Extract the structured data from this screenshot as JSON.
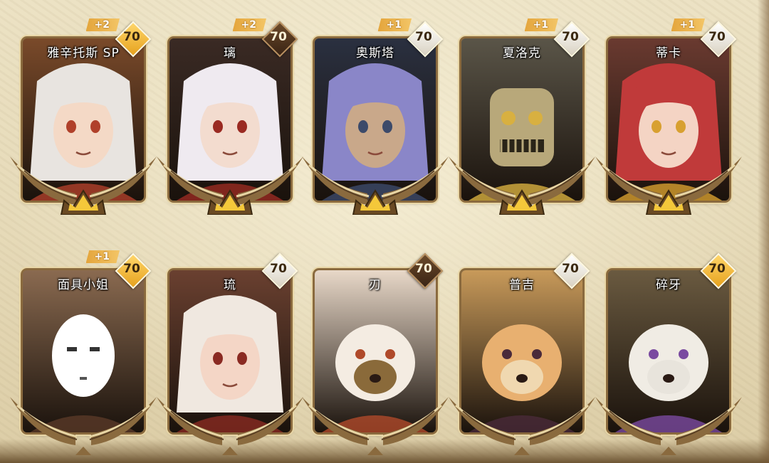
{
  "heroes": [
    {
      "name": "雅辛托斯 SP",
      "level": "70",
      "plus": "+2",
      "badge": "gold",
      "row": 1,
      "palette": {
        "bg": "#7a4a2a",
        "hair": "#e8e4e0",
        "skin": "#f4d9c6",
        "accent": "#b0402a"
      }
    },
    {
      "name": "璃",
      "level": "70",
      "plus": "+2",
      "badge": "dark",
      "row": 1,
      "palette": {
        "bg": "#3a2a24",
        "hair": "#efeaf0",
        "skin": "#f3dccf",
        "accent": "#9a2a22"
      }
    },
    {
      "name": "奥斯塔",
      "level": "70",
      "plus": "+1",
      "badge": "white",
      "row": 1,
      "palette": {
        "bg": "#2a3040",
        "hair": "#8a86c8",
        "skin": "#c9a88a",
        "accent": "#3c4a6a"
      }
    },
    {
      "name": "夏洛克",
      "level": "70",
      "plus": "+1",
      "badge": "white",
      "row": 1,
      "palette": {
        "bg": "#5a5548",
        "hair": "#7a7a6a",
        "skin": "#b8a87a",
        "accent": "#d8b040"
      }
    },
    {
      "name": "蒂卡",
      "level": "70",
      "plus": "+1",
      "badge": "white",
      "row": 1,
      "palette": {
        "bg": "#6a3a30",
        "hair": "#c03a3a",
        "skin": "#f4d4c4",
        "accent": "#d8a030"
      }
    },
    {
      "name": "面具小姐",
      "level": "70",
      "plus": "+1",
      "badge": "gold",
      "row": 2,
      "palette": {
        "bg": "#8a6a50",
        "hair": "#f4f0ea",
        "skin": "#ffffff",
        "accent": "#5a3a28"
      }
    },
    {
      "name": "琉",
      "level": "70",
      "plus": "",
      "badge": "white",
      "row": 2,
      "palette": {
        "bg": "#6a4030",
        "hair": "#f0e8e0",
        "skin": "#f4d6c6",
        "accent": "#8a2a22"
      }
    },
    {
      "name": "刃",
      "level": "70",
      "plus": "",
      "badge": "dark",
      "row": 2,
      "palette": {
        "bg": "#e8d8c8",
        "hair": "#f4ece2",
        "skin": "#8a6a3a",
        "accent": "#b04a2a"
      }
    },
    {
      "name": "普吉",
      "level": "70",
      "plus": "",
      "badge": "white",
      "row": 2,
      "palette": {
        "bg": "#c89a5a",
        "hair": "#e8b070",
        "skin": "#f0d8b0",
        "accent": "#4a2a3a"
      }
    },
    {
      "name": "碎牙",
      "level": "70",
      "plus": "",
      "badge": "gold",
      "row": 2,
      "palette": {
        "bg": "#6a5a40",
        "hair": "#f0ece4",
        "skin": "#e8e4dc",
        "accent": "#7a4aa0"
      }
    }
  ],
  "icons": {
    "emblem": "golden-wing-crown-icon"
  },
  "colors": {
    "emblem_gold": "#f4c83a",
    "frame_bronze": "#8a6a3e"
  }
}
